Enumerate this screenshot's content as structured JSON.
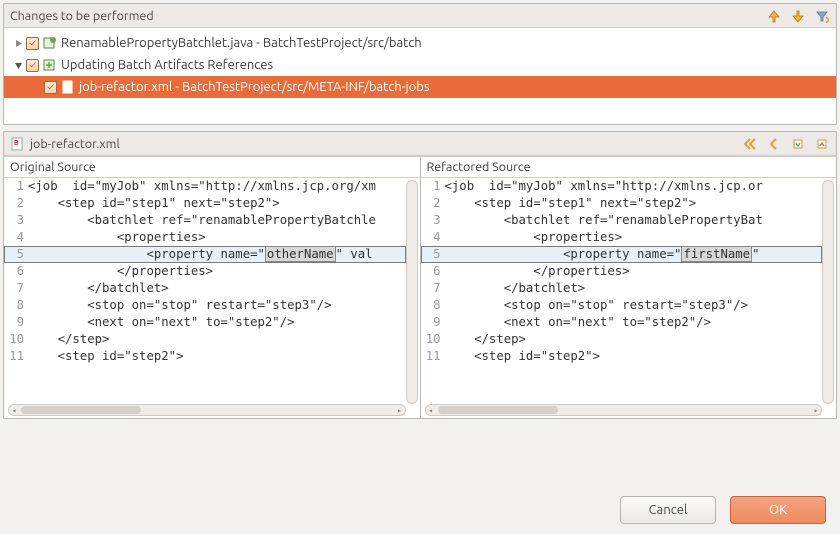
{
  "top": {
    "title": "Changes to be performed",
    "items": [
      {
        "label": "RenamablePropertyBatchlet.java - BatchTestProject/src/batch",
        "expanded": false,
        "depth": 0,
        "icon": "java-change"
      },
      {
        "label": "Updating Batch Artifacts References",
        "expanded": true,
        "depth": 0,
        "icon": "refs"
      },
      {
        "label": "job-refactor.xml - BatchTestProject/src/META-INF/batch-jobs",
        "expanded": null,
        "depth": 1,
        "icon": "xml",
        "selected": true
      }
    ]
  },
  "compare": {
    "file_label": "job-refactor.xml",
    "left_title": "Original Source",
    "right_title": "Refactored Source",
    "left_lines": [
      "<job  id=\"myJob\" xmlns=\"http://xmlns.jcp.org/xm",
      "    <step id=\"step1\" next=\"step2\">",
      "        <batchlet ref=\"renamablePropertyBatchle",
      "            <properties>",
      "                <property name=\"otherName\" val",
      "            </properties>",
      "        </batchlet>",
      "        <stop on=\"stop\" restart=\"step3\"/>",
      "        <next on=\"next\" to=\"step2\"/>",
      "    </step>",
      "    <step id=\"step2\">"
    ],
    "right_lines": [
      "<job  id=\"myJob\" xmlns=\"http://xmlns.jcp.or",
      "    <step id=\"step1\" next=\"step2\">",
      "        <batchlet ref=\"renamablePropertyBat",
      "            <properties>",
      "                <property name=\"firstName\" ",
      "            </properties>",
      "        </batchlet>",
      "        <stop on=\"stop\" restart=\"step3\"/>",
      "        <next on=\"next\" to=\"step2\"/>",
      "    </step>",
      "    <step id=\"step2\">"
    ],
    "diff_row_index": 4,
    "left_hl": "otherName",
    "right_hl": "firstName"
  },
  "buttons": {
    "cancel": "Cancel",
    "ok": "OK"
  }
}
